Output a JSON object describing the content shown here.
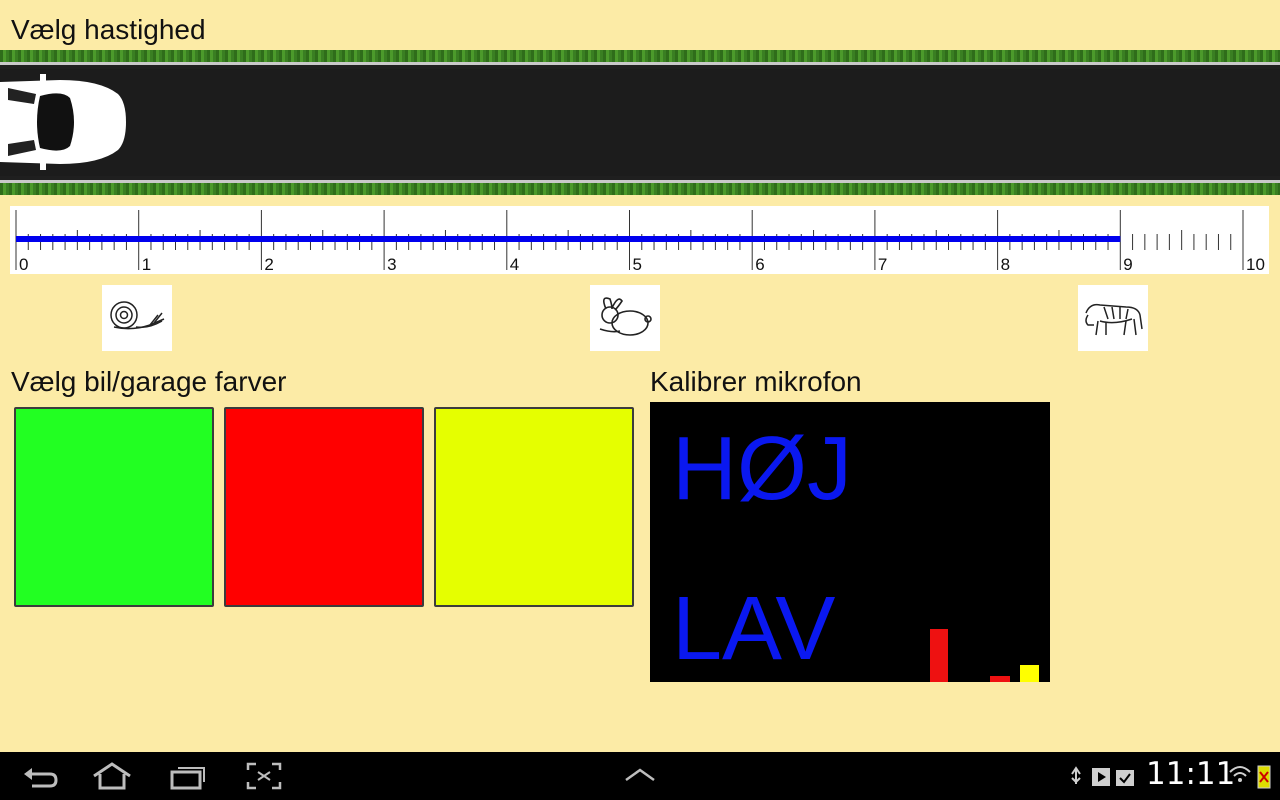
{
  "headings": {
    "speed": "Vælg hastighed",
    "colors": "Vælg bil/garage farver",
    "mic": "Kalibrer mikrofon"
  },
  "speed_scale": {
    "labels": [
      "0",
      "1",
      "2",
      "3",
      "4",
      "5",
      "6",
      "7",
      "8",
      "9",
      "10"
    ],
    "min": 0,
    "max": 10,
    "selected_value": 9,
    "accent_color": "#0000EE"
  },
  "speed_icons": [
    "snail-icon",
    "rabbit-icon",
    "tiger-icon"
  ],
  "colors": {
    "options": [
      {
        "name": "green",
        "hex": "#22FF22"
      },
      {
        "name": "red",
        "hex": "#FF0000"
      },
      {
        "name": "yellow",
        "hex": "#E5FF00"
      }
    ]
  },
  "mic": {
    "high_label": "HØJ",
    "low_label": "LAV",
    "label_color": "#0A18F0",
    "level_bars": [
      {
        "color": "#EE1111",
        "level": 0.19
      },
      {
        "color": "#EE1111",
        "level": 0.02
      },
      {
        "color": "#FFFF00",
        "level": 0.06
      }
    ]
  },
  "status_bar": {
    "time": "11:11"
  }
}
